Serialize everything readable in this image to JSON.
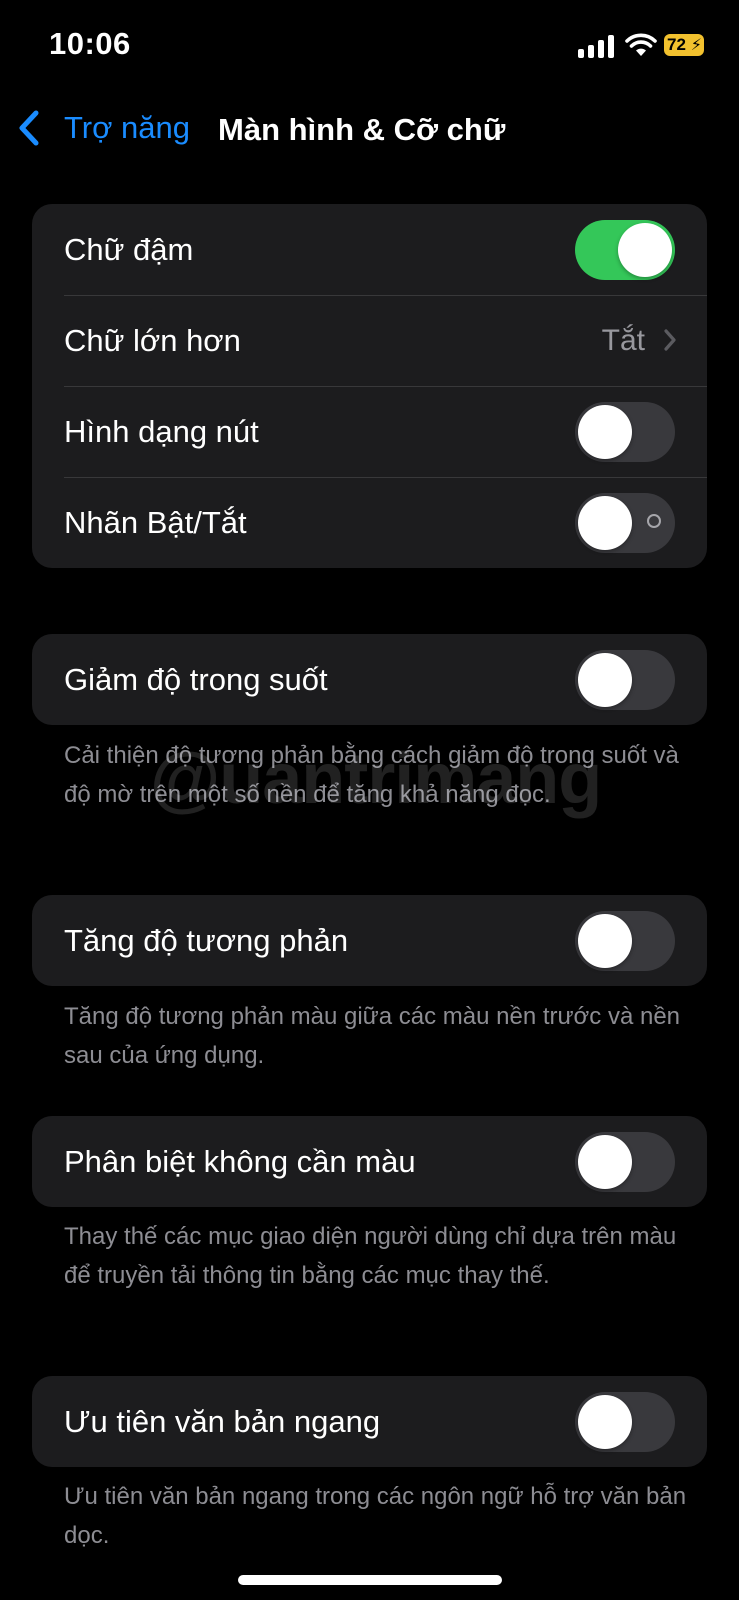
{
  "status": {
    "time": "10:06",
    "battery": "72"
  },
  "nav": {
    "back_label": "Trợ năng",
    "title": "Màn hình & Cỡ chữ"
  },
  "group1": {
    "bold_text": {
      "label": "Chữ đậm",
      "on": true
    },
    "larger_text": {
      "label": "Chữ lớn hơn",
      "value": "Tắt"
    },
    "button_shapes": {
      "label": "Hình dạng nút",
      "on": false
    },
    "on_off_labels": {
      "label": "Nhãn Bật/Tắt",
      "on": false
    }
  },
  "reduce_transparency": {
    "label": "Giảm độ trong suốt",
    "on": false,
    "footnote": "Cải thiện độ tương phản bằng cách giảm độ trong suốt và độ mờ trên một số nền để tăng khả năng đọc."
  },
  "increase_contrast": {
    "label": "Tăng độ tương phản",
    "on": false,
    "footnote": "Tăng độ tương phản màu giữa các màu nền trước và nền sau của ứng dụng."
  },
  "differentiate_without_color": {
    "label": "Phân biệt không cần màu",
    "on": false,
    "footnote": "Thay thế các mục giao diện người dùng chỉ dựa trên màu để truyền tải thông tin bằng các mục thay thế."
  },
  "prefer_horizontal_text": {
    "label": "Ưu tiên văn bản ngang",
    "on": false,
    "footnote": "Ưu tiên văn bản ngang trong các ngôn ngữ hỗ trợ văn bản dọc."
  },
  "watermark": "@uantrimang",
  "colors": {
    "accent": "#1a8cff",
    "toggle_on": "#34c759",
    "cell_bg": "#1c1c1e",
    "battery": "#f2c12e"
  }
}
